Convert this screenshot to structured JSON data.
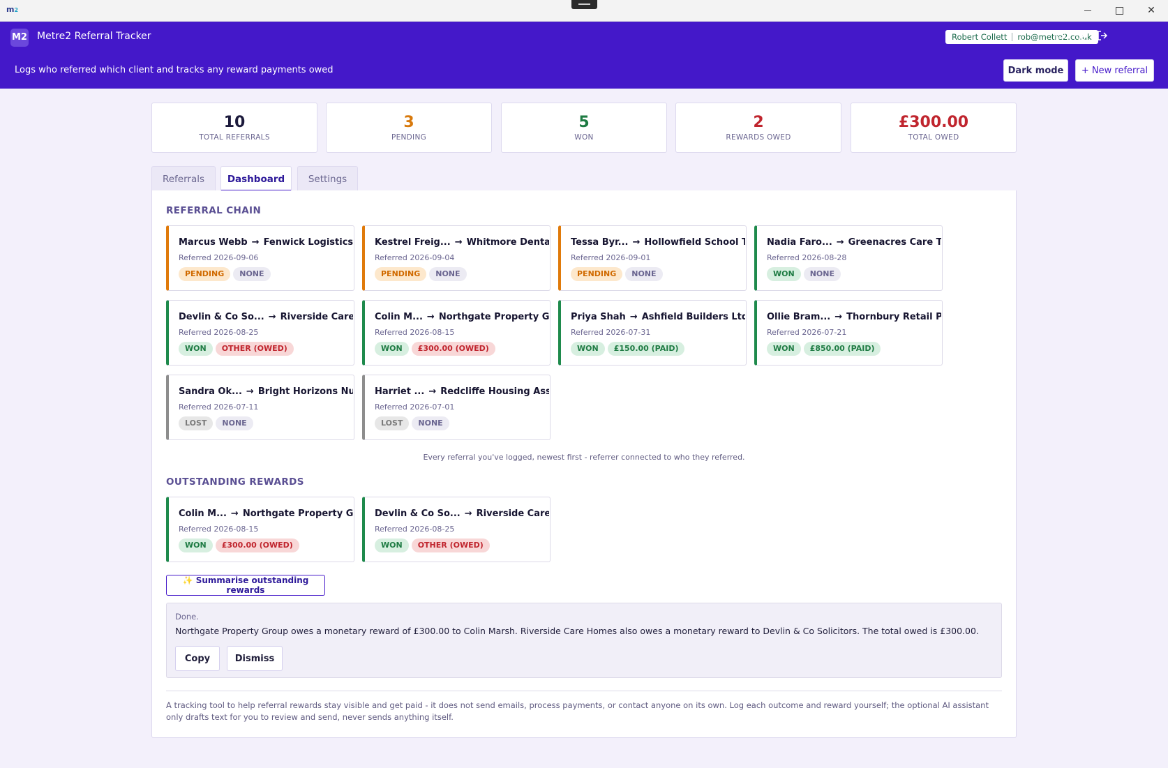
{
  "window": {
    "logo_main": "m",
    "logo_sub": "2"
  },
  "header": {
    "badge": "M2",
    "title": "Metre2 Referral Tracker",
    "user_name": "Robert Collett",
    "user_email": "rob@metre2.co.uk",
    "tagline": "Logs who referred which client and tracks any reward payments owed",
    "dark_mode_label": "Dark mode",
    "new_referral_label": "+ New referral"
  },
  "stats": [
    {
      "value": "10",
      "label": "TOTAL REFERRALS",
      "color": "#1c1a3c"
    },
    {
      "value": "3",
      "label": "PENDING",
      "color": "#d8790c"
    },
    {
      "value": "5",
      "label": "WON",
      "color": "#1e7b43"
    },
    {
      "value": "2",
      "label": "REWARDS OWED",
      "color": "#c0252e"
    },
    {
      "value": "£300.00",
      "label": "TOTAL OWED",
      "color": "#c0252e"
    }
  ],
  "tabs": [
    {
      "label": "Referrals",
      "active": false
    },
    {
      "label": "Dashboard",
      "active": true
    },
    {
      "label": "Settings",
      "active": false
    }
  ],
  "chain": {
    "title": "REFERRAL CHAIN",
    "note": "Every referral you've logged, newest first - referrer connected to who they referred.",
    "cards": [
      {
        "referrer": "Marcus Webb",
        "client": "Fenwick Logistics",
        "date": "Referred 2026-09-06",
        "status": "PENDING",
        "status_class": "pending",
        "reward": "NONE",
        "reward_class": "none"
      },
      {
        "referrer": "Kestrel Freig...",
        "client": "Whitmore Dental ...",
        "date": "Referred 2026-09-04",
        "status": "PENDING",
        "status_class": "pending",
        "reward": "NONE",
        "reward_class": "none"
      },
      {
        "referrer": "Tessa Byr...",
        "client": "Hollowfield School Tr...",
        "date": "Referred 2026-09-01",
        "status": "PENDING",
        "status_class": "pending",
        "reward": "NONE",
        "reward_class": "none"
      },
      {
        "referrer": "Nadia Faro...",
        "client": "Greenacres Care Tr...",
        "date": "Referred 2026-08-28",
        "status": "WON",
        "status_class": "won",
        "reward": "NONE",
        "reward_class": "none"
      },
      {
        "referrer": "Devlin & Co So...",
        "client": "Riverside Care ...",
        "date": "Referred 2026-08-25",
        "status": "WON",
        "status_class": "won",
        "reward": "OTHER (OWED)",
        "reward_class": "owed"
      },
      {
        "referrer": "Colin M...",
        "client": "Northgate Property G...",
        "date": "Referred 2026-08-15",
        "status": "WON",
        "status_class": "won",
        "reward": "£300.00 (OWED)",
        "reward_class": "owed"
      },
      {
        "referrer": "Priya Shah",
        "client": "Ashfield Builders Ltd",
        "date": "Referred 2026-07-31",
        "status": "WON",
        "status_class": "won",
        "reward": "£150.00 (PAID)",
        "reward_class": "paid"
      },
      {
        "referrer": "Ollie Bram...",
        "client": "Thornbury Retail P...",
        "date": "Referred 2026-07-21",
        "status": "WON",
        "status_class": "won",
        "reward": "£850.00 (PAID)",
        "reward_class": "paid"
      },
      {
        "referrer": "Sandra Ok...",
        "client": "Bright Horizons Nu...",
        "date": "Referred 2026-07-11",
        "status": "LOST",
        "status_class": "lost",
        "reward": "NONE",
        "reward_class": "none"
      },
      {
        "referrer": "Harriet ...",
        "client": "Redcliffe Housing Ass...",
        "date": "Referred 2026-07-01",
        "status": "LOST",
        "status_class": "lost",
        "reward": "NONE",
        "reward_class": "none"
      }
    ]
  },
  "outstanding": {
    "title": "OUTSTANDING REWARDS",
    "cards": [
      {
        "referrer": "Colin M...",
        "client": "Northgate Property G...",
        "date": "Referred 2026-08-15",
        "status": "WON",
        "status_class": "won",
        "reward": "£300.00 (OWED)",
        "reward_class": "owed"
      },
      {
        "referrer": "Devlin & Co So...",
        "client": "Riverside Care ...",
        "date": "Referred 2026-08-25",
        "status": "WON",
        "status_class": "won",
        "reward": "OTHER (OWED)",
        "reward_class": "owed"
      }
    ],
    "summarise_label": "✨ Summarise outstanding rewards"
  },
  "summary": {
    "status": "Done.",
    "text": "Northgate Property Group owes a monetary reward of £300.00 to Colin Marsh. Riverside Care Homes also owes a monetary reward to Devlin & Co Solicitors. The total owed is £300.00.",
    "copy_label": "Copy",
    "dismiss_label": "Dismiss"
  },
  "footer": {
    "note": "A tracking tool to help referral rewards stay visible and get paid - it does not send emails, process payments, or contact anyone on its own. Log each outcome and reward yourself; the optional AI assistant only drafts text for you to review and send, never sends anything itself."
  },
  "icons": {
    "chat": "chat-icon",
    "settings": "gear-icon",
    "logout": "logout-icon"
  },
  "colors": {
    "brand": "#4418c9",
    "pending": "#e07a0a",
    "won": "#1e8a4c",
    "lost": "#8d8d8d",
    "owed": "#c0252e"
  }
}
